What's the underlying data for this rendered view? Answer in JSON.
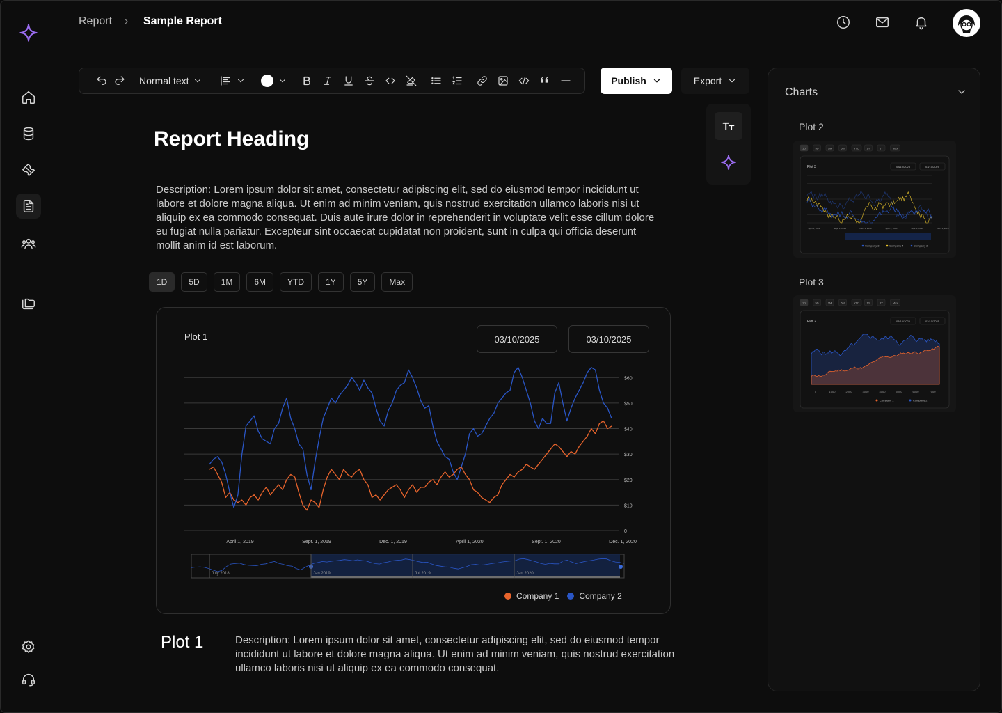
{
  "header": {
    "breadcrumb_root": "Report",
    "breadcrumb_sep": "›",
    "breadcrumb_current": "Sample Report"
  },
  "toolbar": {
    "text_style": "Normal text",
    "publish_label": "Publish",
    "export_label": "Export"
  },
  "doc": {
    "heading": "Report Heading",
    "description": "Description: Lorem ipsum dolor sit amet, consectetur adipiscing elit, sed do eiusmod tempor incididunt ut labore et dolore magna aliqua. Ut enim ad minim veniam, quis nostrud exercitation ullamco laboris nisi ut aliquip ex ea commodo consequat. Duis aute irure dolor in reprehenderit in voluptate velit esse cillum dolore eu fugiat nulla pariatur. Excepteur sint occaecat cupidatat non proident, sunt in culpa qui officia deserunt mollit anim id est laborum.",
    "ranges": [
      "1D",
      "5D",
      "1M",
      "6M",
      "YTD",
      "1Y",
      "5Y",
      "Max"
    ],
    "active_range": "1D"
  },
  "plot1": {
    "title": "Plot 1",
    "date_from": "03/10/2025",
    "date_to": "03/10/2025",
    "caption_title": "Plot 1",
    "caption_desc": "Description: Lorem ipsum dolor sit amet, consectetur adipiscing elit, sed do eiusmod tempor incididunt ut labore et dolore magna aliqua. Ut enim ad minim veniam, quis nostrud exercitation ullamco laboris nisi ut aliquip ex ea commodo consequat."
  },
  "chart_data": {
    "type": "line",
    "title": "Plot 1",
    "x_ticks": [
      "April 1, 2019",
      "Sept. 1, 2019",
      "Dec. 1, 2019",
      "April 1, 2020",
      "Sept. 1, 2020",
      "Dec. 1, 2020"
    ],
    "y_ticks": [
      "0",
      "$10",
      "$20",
      "$30",
      "$40",
      "$50",
      "$60"
    ],
    "ylim": [
      0,
      65
    ],
    "navigator_ticks": [
      "July 2018",
      "Jan 2019",
      "Jul 2019",
      "Jan 2020"
    ],
    "legend_position": "bottom-right",
    "series": [
      {
        "name": "Company 1",
        "color": "#e8642c",
        "values": [
          24,
          25,
          22,
          19,
          13,
          15,
          12,
          11,
          12,
          10,
          13,
          14,
          12,
          15,
          17,
          14,
          16,
          18,
          16,
          20,
          22,
          21,
          15,
          10,
          8,
          12,
          11,
          9,
          16,
          21,
          24,
          22,
          20,
          24,
          22,
          21,
          23,
          24,
          20,
          18,
          13,
          14,
          12,
          14,
          16,
          17,
          18,
          16,
          13,
          16,
          18,
          15,
          17,
          17,
          19,
          20,
          18,
          21,
          23,
          21,
          22,
          24,
          25,
          22,
          20,
          16,
          15,
          13,
          12,
          11,
          13,
          14,
          18,
          20,
          22,
          21,
          23,
          24,
          26,
          25,
          24,
          26,
          28,
          30,
          32,
          34,
          33,
          31,
          29,
          31,
          30,
          33,
          35,
          37,
          40,
          38,
          42,
          43,
          40,
          41
        ]
      },
      {
        "name": "Company 2",
        "color": "#2a56c6",
        "values": [
          26,
          28,
          29,
          27,
          22,
          15,
          9,
          14,
          30,
          41,
          43,
          45,
          39,
          36,
          35,
          34,
          40,
          42,
          48,
          52,
          44,
          40,
          34,
          32,
          22,
          16,
          27,
          36,
          44,
          48,
          52,
          50,
          53,
          55,
          57,
          60,
          58,
          55,
          59,
          56,
          54,
          48,
          43,
          41,
          47,
          50,
          55,
          57,
          58,
          63,
          60,
          56,
          51,
          48,
          49,
          41,
          35,
          32,
          29,
          28,
          23,
          20,
          25,
          30,
          38,
          40,
          37,
          38,
          41,
          44,
          46,
          50,
          52,
          54,
          55,
          62,
          64,
          60,
          55,
          50,
          43,
          40,
          44,
          42,
          42,
          54,
          58,
          50,
          43,
          48,
          52,
          55,
          58,
          62,
          64,
          63,
          55,
          50,
          48,
          44
        ]
      }
    ]
  },
  "right_panel": {
    "title": "Charts",
    "items": [
      {
        "label": "Plot 2",
        "thumb_title": "Plot 3",
        "thumb_legend": [
          "Company 3",
          "Company 4",
          "Company 2"
        ]
      },
      {
        "label": "Plot 3",
        "thumb_title": "Plot 2",
        "thumb_legend": [
          "Company 1",
          "Company 2"
        ]
      }
    ],
    "thumb_ranges": [
      "1D",
      "5D",
      "1M",
      "6M",
      "YTD",
      "1Y",
      "5Y",
      "Max"
    ],
    "thumb_date": "03/10/2025",
    "thumb1_x_ticks": [
      "April 1, 2019",
      "Sept. 1, 2019",
      "Dec. 1, 2019",
      "April 1, 2020",
      "Sept. 1, 2020",
      "Dec. 1, 2020"
    ],
    "thumb2_x_ticks": [
      "0",
      "1000",
      "2000",
      "3000",
      "4000",
      "5000",
      "6000",
      "7000"
    ]
  },
  "icons": {
    "logo": "sparkle-icon",
    "sidebar": [
      "home-icon",
      "database-icon",
      "wrench-icon",
      "report-icon",
      "users-icon",
      "folders-icon",
      "settings-icon",
      "headset-icon"
    ],
    "header": [
      "clock-icon",
      "mail-icon",
      "bell-icon",
      "avatar"
    ]
  },
  "colors": {
    "background": "#0d0d0d",
    "company1": "#e8642c",
    "company2": "#2a56c6",
    "accent_sparkle": "#9a6cf0",
    "company3": "#e8c32c"
  }
}
